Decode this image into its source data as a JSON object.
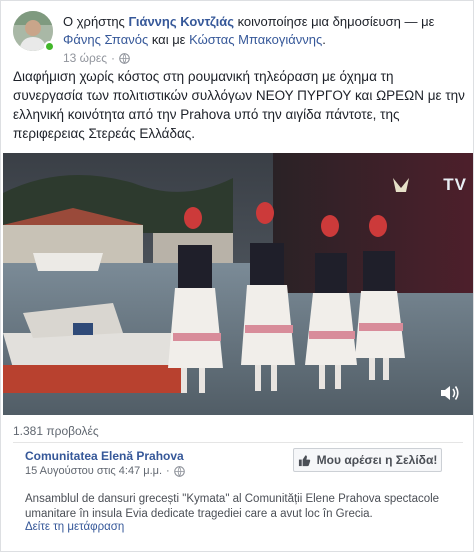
{
  "header": {
    "prefix": "Ο χρήστης ",
    "author": "Γιάννης Κοντζιάς",
    "middle": " κοινοποίησε μια δημοσίευση — με ",
    "tag1": "Φάνης Σπανός",
    "and": " και με ",
    "tag2": "Κώστας Μπακογιάννης",
    "end": ".",
    "timestamp": "13 ώρες",
    "dot": "·",
    "privacy_icon": "globe-icon"
  },
  "post": {
    "text": "Διαφήμιση χωρίς κόστος στη ρουμανική τηλεόραση με όχημα τη συνεργασία των πολιτιστικών συλλόγων ΝΕΟΥ ΠΥΡΓΟΥ και ΩΡΕΩΝ με την ελληνική κοινότητα από την Prahova υπό την αιγίδα πάντοτε, της περιφερειας Στερεάς Ελλάδας."
  },
  "video": {
    "logo_text": "TV",
    "volume_icon": "volume-icon"
  },
  "stats": {
    "views": "1.381 προβολές"
  },
  "shared": {
    "page_name": "Comunitatea Elenă Prahova",
    "date": "15 Αυγούστου στις 4:47 μ.μ.",
    "dot": "·",
    "like_button": "Μου αρέσει η Σελίδα!",
    "description": "Ansamblul de dansuri grecești \"Kymata\" al Comunității Elene Prahova spectacole umanitare în insula Evia dedicate tragediei care a avut loc în Grecia.",
    "translate_link": "Δείτε τη μετάφραση"
  },
  "colors": {
    "link": "#365899",
    "online": "#42b72a",
    "muted": "#90949c"
  }
}
